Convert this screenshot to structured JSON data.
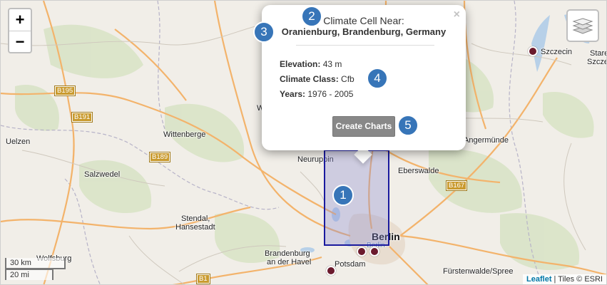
{
  "popup": {
    "heading": "Climate Cell Near:",
    "place": "Oranienburg, Brandenburg, Germany",
    "close": "×",
    "elevation_label": "Elevation:",
    "elevation_value": "43 m",
    "climate_label": "Climate Class:",
    "climate_value": "Cfb",
    "years_label": "Years:",
    "years_value": "1976 - 2005",
    "button": "Create Charts"
  },
  "badges": [
    "1",
    "2",
    "3",
    "4",
    "5"
  ],
  "zoom": {
    "in": "+",
    "out": "−"
  },
  "scale": {
    "metric": "30 km",
    "imperial": "20 mi"
  },
  "attribution": {
    "leaflet": "Leaflet",
    "separator": " | ",
    "tiles": "Tiles © ESRI"
  },
  "places": {
    "szczecin": "Szczecin",
    "stare": "Stare",
    "szcze": "Szcze",
    "uelzen": "Uelzen",
    "wittenberge": "Wittenberge",
    "salzwedel": "Salzwedel",
    "stendal": "Stendal,",
    "hansestadt": "Hansestadt",
    "wolfsburg": "Wolfsburg",
    "brandenburg1": "Brandenburg",
    "brandenburg2": "an der Havel",
    "potsdam": "Potsdam",
    "berlin": "Berlin",
    "berlin_small": "Berlin",
    "neuruppin": "Neuruppin",
    "eberswalde": "Eberswalde",
    "angermunde": "Angermünde",
    "furstenwalde": "Fürstenwalde/Spree",
    "w": "W"
  },
  "roads": [
    "B195",
    "B191",
    "B189",
    "B167",
    "B1"
  ],
  "colors": {
    "station": "#6b1a2d",
    "cell_border": "#1a1a9e",
    "badge": "#3775b8"
  }
}
